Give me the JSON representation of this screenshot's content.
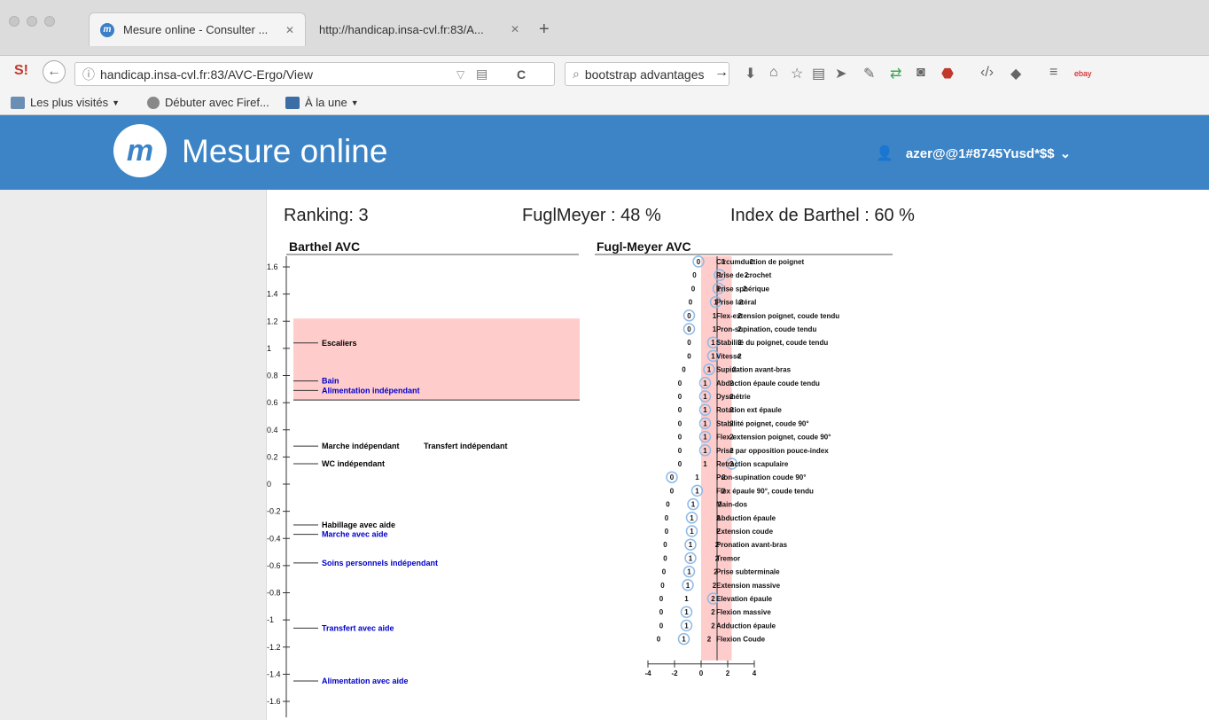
{
  "browser": {
    "tabs": [
      {
        "title": "Mesure online - Consulter ..."
      },
      {
        "title": "http://handicap.insa-cvl.fr:83/A..."
      }
    ],
    "url": "handicap.insa-cvl.fr:83/AVC-Ergo/View",
    "search": "bootstrap advantages",
    "bookmarks": [
      "Les plus visités",
      "Débuter avec Firef...",
      "À la une"
    ]
  },
  "site": {
    "logo_letter": "m",
    "title": "Mesure online",
    "user": "azer@@1#8745Yusd*$$"
  },
  "scores": {
    "ranking": "Ranking: 3",
    "fuglmeyer": "FuglMeyer : 48 %",
    "barthel": "Index de Barthel : 60 %"
  },
  "chart_data": [
    {
      "type": "scatter",
      "title": "Barthel AVC",
      "ylim": [
        -1.7,
        1.7
      ],
      "yticks": [
        1.6,
        1.4,
        1.2,
        1,
        0.8,
        0.6,
        0.4,
        0.2,
        0,
        -0.2,
        -0.4,
        -0.6,
        -0.8,
        -1,
        -1.2,
        -1.4,
        -1.6
      ],
      "ytick_labels": [
        "1.6",
        "1.4",
        "1.2",
        "1",
        "0.8",
        "0.6",
        "0.4",
        "0.2",
        "0",
        "-0.2",
        "-0.4",
        "-0.6",
        "-0.8",
        "-1",
        "-1.2",
        "-1.4",
        "-1.6"
      ],
      "highlight_band": [
        0.62,
        1.22
      ],
      "highlight_color": "#ffcccc",
      "items": [
        {
          "label": "Escaliers",
          "y": 1.04,
          "color": "#000000",
          "col": 0
        },
        {
          "label": "Bain",
          "y": 0.76,
          "color": "#0000cc",
          "col": 0
        },
        {
          "label": "Alimentation indépendant",
          "y": 0.69,
          "color": "#0000cc",
          "col": 0
        },
        {
          "label": "Marche indépendant",
          "y": 0.28,
          "color": "#000000",
          "col": 0
        },
        {
          "label": "Transfert indépendant",
          "y": 0.28,
          "color": "#000000",
          "col": 1
        },
        {
          "label": "WC indépendant",
          "y": 0.15,
          "color": "#000000",
          "col": 0
        },
        {
          "label": "Habillage avec aide",
          "y": -0.3,
          "color": "#000000",
          "col": 0
        },
        {
          "label": "Marche avec aide",
          "y": -0.37,
          "color": "#0000cc",
          "col": 0
        },
        {
          "label": "Soins personnels indépendant",
          "y": -0.58,
          "color": "#0000cc",
          "col": 0
        },
        {
          "label": "Transfert avec aide",
          "y": -1.06,
          "color": "#0000cc",
          "col": 0
        },
        {
          "label": "Alimentation avec aide",
          "y": -1.45,
          "color": "#0000cc",
          "col": 0
        }
      ]
    },
    {
      "type": "scatter",
      "title": "Fugl-Meyer AVC",
      "xlim": [
        -4,
        4
      ],
      "xticks": [
        -4,
        -2,
        0,
        2,
        4
      ],
      "band": [
        0,
        2.3
      ],
      "band_color": "#ffcccc",
      "ref_line": 1.2,
      "items": [
        {
          "label": "Circumduction de poignet",
          "pos": [
            -0.2,
            1.7,
            3.8
          ],
          "score": 0
        },
        {
          "label": "Prise de crochet",
          "pos": [
            -0.5,
            1.4,
            3.4
          ],
          "score": 1
        },
        {
          "label": "Prise sphérique",
          "pos": [
            -0.6,
            1.3,
            3.3
          ],
          "score": 1
        },
        {
          "label": "Prise latéral",
          "pos": [
            -0.8,
            1.1,
            3.0
          ],
          "score": 1
        },
        {
          "label": "Flex-extension poignet, coude tendu",
          "pos": [
            -0.9,
            1.0,
            2.9
          ],
          "score": 0
        },
        {
          "label": "Pron-supination, coude tendu",
          "pos": [
            -0.9,
            1.0,
            2.9
          ],
          "score": 0
        },
        {
          "label": "Stabilité du poignet, coude tendu",
          "pos": [
            -0.9,
            0.9,
            2.9
          ],
          "score": 1
        },
        {
          "label": "Vitesse",
          "pos": [
            -0.9,
            0.9,
            2.9
          ],
          "score": 1
        },
        {
          "label": "Supination avant-bras",
          "pos": [
            -1.3,
            0.6,
            2.5
          ],
          "score": 1
        },
        {
          "label": "Abduction épaule coude tendu",
          "pos": [
            -1.6,
            0.3,
            2.3
          ],
          "score": 1
        },
        {
          "label": "Dysmétrie",
          "pos": [
            -1.6,
            0.3,
            2.3
          ],
          "score": 1
        },
        {
          "label": "Rotation ext épaule",
          "pos": [
            -1.6,
            0.3,
            2.3
          ],
          "score": 1
        },
        {
          "label": "Stabilité poignet, coude 90°",
          "pos": [
            -1.6,
            0.3,
            2.3
          ],
          "score": 1
        },
        {
          "label": "Flex-extension poignet, coude 90°",
          "pos": [
            -1.6,
            0.3,
            2.3
          ],
          "score": 1
        },
        {
          "label": "Prise par opposition pouce-index",
          "pos": [
            -1.6,
            0.3,
            2.3
          ],
          "score": 1
        },
        {
          "label": "Retraction scapulaire",
          "pos": [
            -1.6,
            0.3,
            2.3
          ],
          "score": 2
        },
        {
          "label": "Pron-supination coude 90°",
          "pos": [
            -2.2,
            -0.3,
            1.7
          ],
          "score": 0
        },
        {
          "label": "Flex épaule 90°, coude tendu",
          "pos": [
            -2.2,
            -0.3,
            1.7
          ],
          "score": 1
        },
        {
          "label": "Main-dos",
          "pos": [
            -2.5,
            -0.6,
            1.4
          ],
          "score": 1
        },
        {
          "label": "Abduction épaule",
          "pos": [
            -2.6,
            -0.7,
            1.3
          ],
          "score": 1
        },
        {
          "label": "Extension coude",
          "pos": [
            -2.6,
            -0.7,
            1.3
          ],
          "score": 1
        },
        {
          "label": "Pronation avant-bras",
          "pos": [
            -2.7,
            -0.8,
            1.2
          ],
          "score": 1
        },
        {
          "label": "Tremor",
          "pos": [
            -2.7,
            -0.8,
            1.2
          ],
          "score": 1
        },
        {
          "label": "Prise subterminale",
          "pos": [
            -2.8,
            -0.9,
            1.1
          ],
          "score": 1
        },
        {
          "label": "Extension massive",
          "pos": [
            -2.9,
            -1.0,
            1.0
          ],
          "score": 1
        },
        {
          "label": "Elevation épaule",
          "pos": [
            -3.0,
            -1.1,
            0.9
          ],
          "score": 2
        },
        {
          "label": "Flexion massive",
          "pos": [
            -3.0,
            -1.1,
            0.9
          ],
          "score": 1
        },
        {
          "label": "Adduction épaule",
          "pos": [
            -3.0,
            -1.1,
            0.9
          ],
          "score": 1
        },
        {
          "label": "Flexion Coude",
          "pos": [
            -3.2,
            -1.3,
            0.6
          ],
          "score": 1
        }
      ]
    }
  ]
}
